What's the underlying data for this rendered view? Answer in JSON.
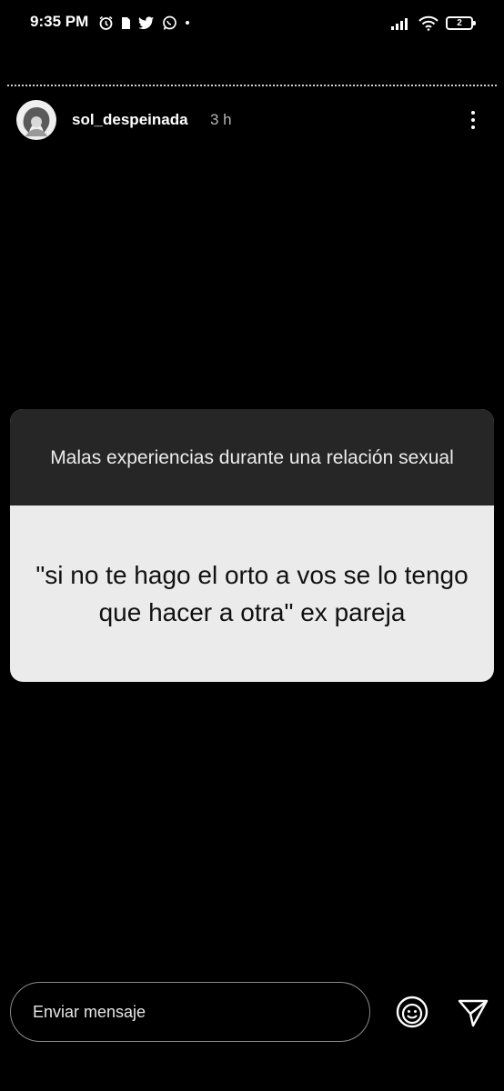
{
  "status_bar": {
    "time": "9:35 PM",
    "left_icons": [
      "alarm-icon",
      "sim-icon",
      "twitter-icon",
      "whatsapp-icon",
      "dot-icon"
    ],
    "right_icons": [
      "signal-icon",
      "wifi-icon",
      "battery-icon"
    ],
    "battery_level": "2"
  },
  "story": {
    "progress_style": "dotted",
    "username": "sol_despeinada",
    "time_ago": "3 h"
  },
  "qa_card": {
    "question": "Malas experiencias durante una relación sexual",
    "answer": "\"si no te hago el orto a vos se lo tengo que hacer a otra\" ex pareja"
  },
  "footer": {
    "message_placeholder": "Enviar mensaje",
    "emoji_icon": "face-sticker-icon",
    "send_icon": "send-icon"
  }
}
